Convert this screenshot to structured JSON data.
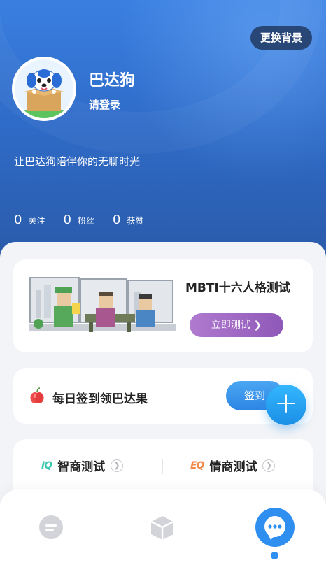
{
  "header": {
    "change_bg_label": "更换背景",
    "nickname": "巴达狗",
    "login_label": "请登录",
    "motto": "让巴达狗陪伴你的无聊时光",
    "stats": [
      {
        "count": "0",
        "label": "关注"
      },
      {
        "count": "0",
        "label": "粉丝"
      },
      {
        "count": "0",
        "label": "获赞"
      }
    ]
  },
  "mbti_card": {
    "title": "MBTI十六人格测试",
    "button_label": "立即测试 ❯"
  },
  "signin_card": {
    "label": "每日签到领巴达果",
    "button_label": "签到"
  },
  "tests_card": {
    "items": [
      {
        "badge": "IQ",
        "name": "智商测试",
        "badge_color": "#3cc7b0"
      },
      {
        "badge": "EQ",
        "name": "情商测试",
        "badge_color": "#f08a4b"
      }
    ]
  },
  "fab": {
    "icon": "plus-icon"
  },
  "tabbar": {
    "tabs": [
      {
        "icon": "home-icon"
      },
      {
        "icon": "box-icon"
      },
      {
        "icon": "chat-icon"
      }
    ],
    "active_index": 2
  },
  "colors": {
    "header": "#2f6cc9",
    "accent": "#2f8ff0",
    "mbti_button": "#9a64c2"
  }
}
